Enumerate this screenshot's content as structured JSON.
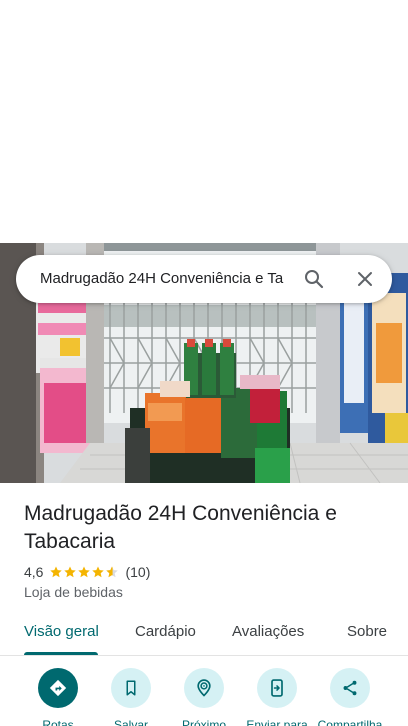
{
  "search": {
    "query": "Madrugadão 24H Conveniência e Ta",
    "search_icon": "search-icon",
    "close_icon": "close-icon"
  },
  "place": {
    "title": "Madrugadão 24H Conveniência e Tabacaria",
    "rating": "4,6",
    "stars": 4.5,
    "review_count": "(10)",
    "category": "Loja de bebidas"
  },
  "tabs": [
    {
      "label": "Visão geral",
      "active": true
    },
    {
      "label": "Cardápio",
      "active": false
    },
    {
      "label": "Avaliações",
      "active": false
    },
    {
      "label": "Sobre",
      "active": false
    }
  ],
  "actions": [
    {
      "label": "Rotas",
      "icon": "directions-icon"
    },
    {
      "label": "Salvar",
      "icon": "bookmark-icon"
    },
    {
      "label": "Próximo",
      "icon": "nearby-icon"
    },
    {
      "label": "Enviar para",
      "icon": "send-to-phone-icon"
    },
    {
      "label": "Compartilha",
      "icon": "share-icon"
    }
  ],
  "colors": {
    "accent": "#00696f",
    "action_bg": "#d5f1f4",
    "star": "#f4b400"
  }
}
